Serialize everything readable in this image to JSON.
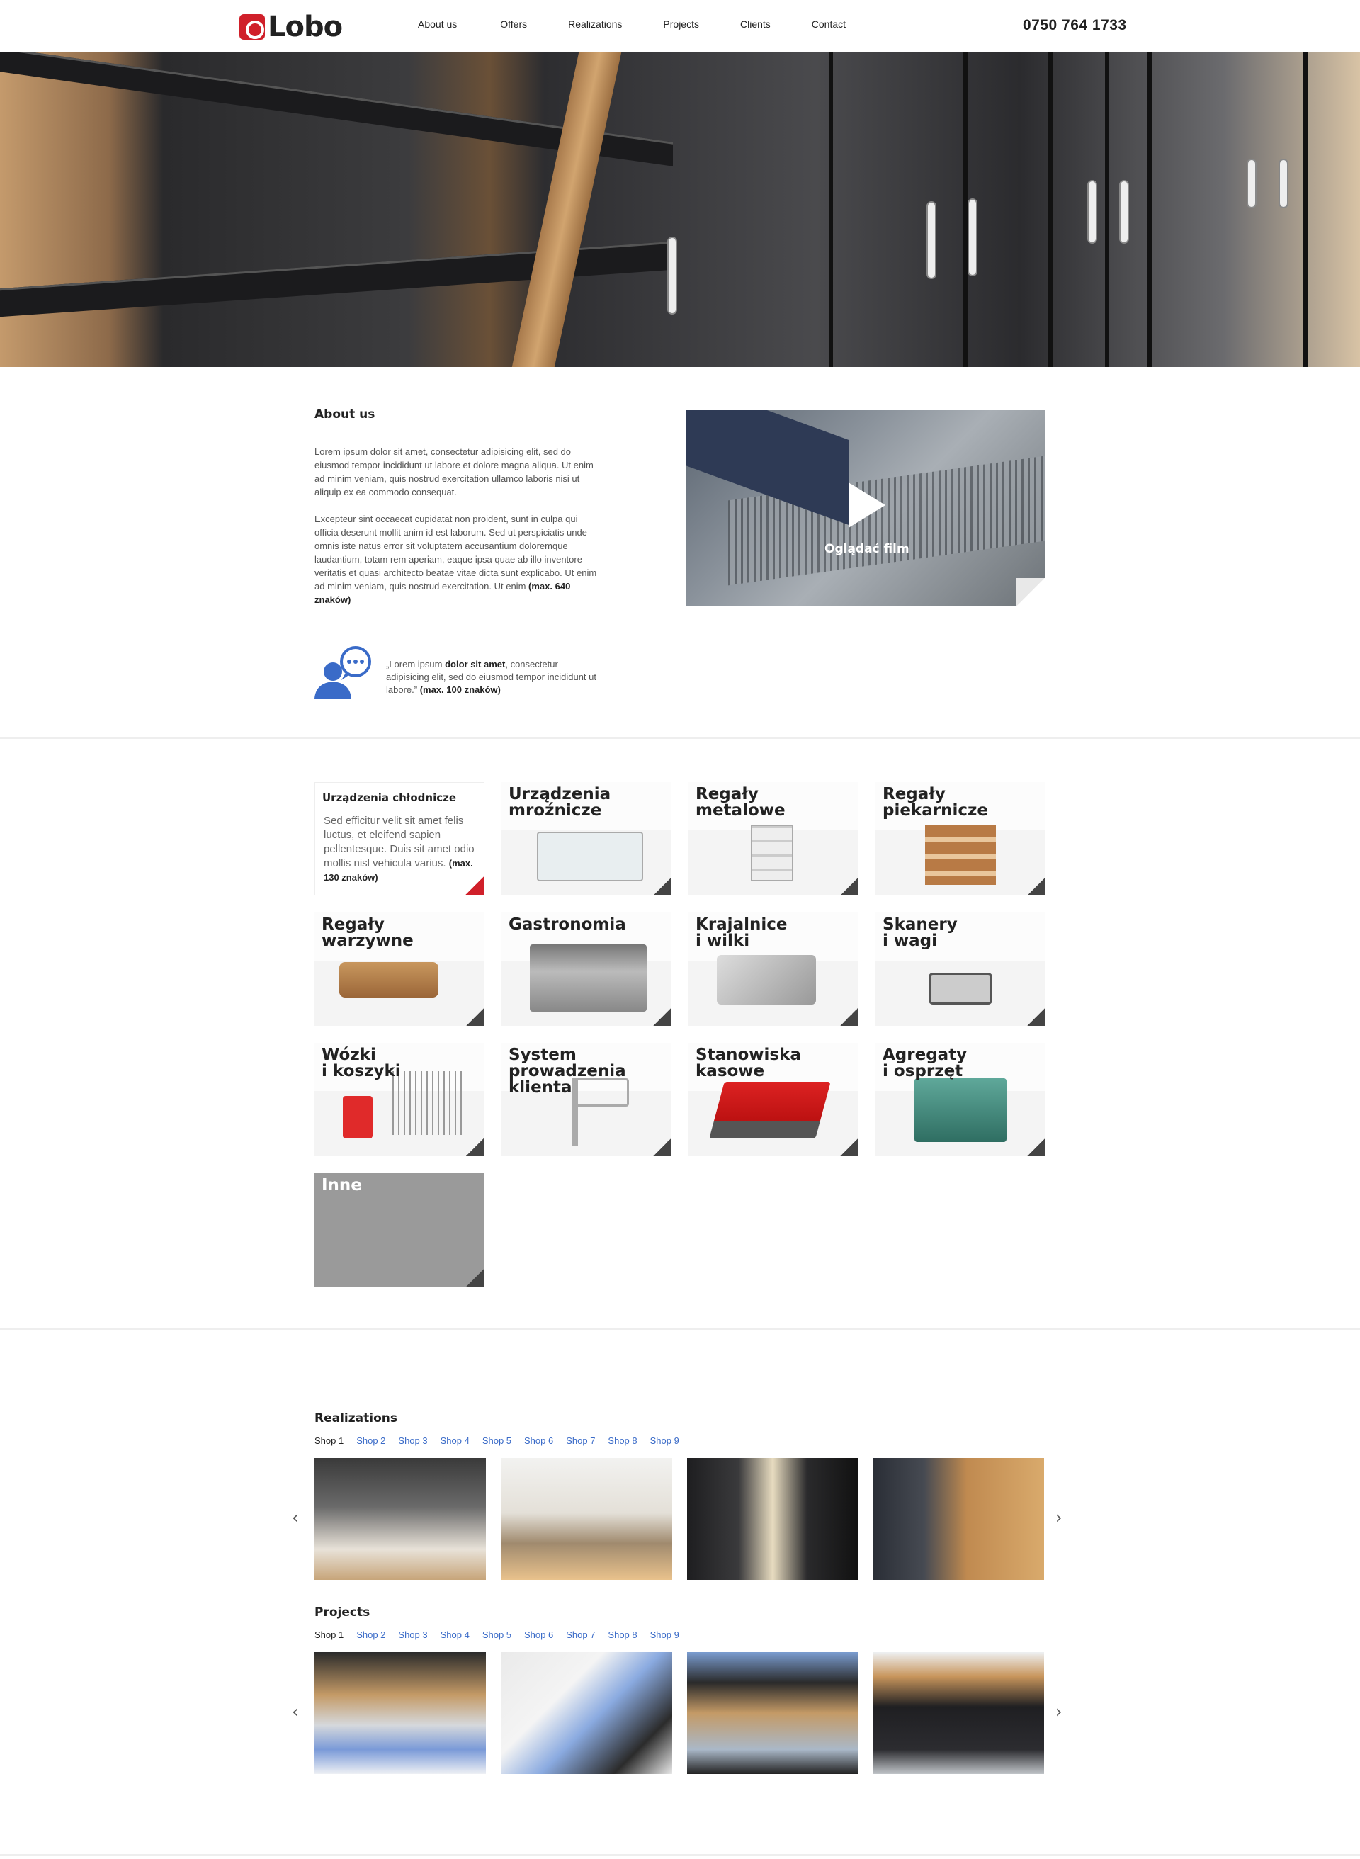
{
  "header": {
    "logo_text": "Lobo",
    "nav": [
      "About us",
      "Offers",
      "Realizations",
      "Projects",
      "Clients",
      "Contact"
    ],
    "phone": "0750 764 1733"
  },
  "about": {
    "title": "About us",
    "paragraph1": "Lorem ipsum dolor sit amet, consectetur adipisicing elit, sed do eiusmod tempor incididunt ut labore et dolore magna aliqua. Ut enim ad minim veniam, quis nostrud exercitation ullamco laboris nisi ut aliquip ex ea commodo consequat.",
    "paragraph2": "Excepteur sint occaecat cupidatat non proident, sunt in culpa qui officia deserunt mollit anim id est laborum. Sed ut perspiciatis unde omnis iste natus error sit voluptatem accusantium doloremque laudantium, totam rem aperiam, eaque ipsa quae ab illo inventore veritatis et quasi architecto beatae vitae dicta sunt explicabo. Ut enim ad minim veniam, quis nostrud exercitation. Ut enim",
    "paragraph2_note": "(max. 640 znaków)",
    "video_label": "Oglądać film",
    "quote_prefix": "„Lorem ipsum",
    "quote_bold": "dolor sit amet",
    "quote_rest": ", consectetur adipisicing elit, sed do eiusmod tempor incididunt ut labore.”",
    "quote_note": "(max. 100 znaków)"
  },
  "categories": [
    {
      "label": "Urządzenia chłodnicze",
      "desc": "Sed efficitur velit sit amet felis luctus, et eleifend sapien pellentesque. Duis sit amet odio mollis nisl vehicula varius.",
      "note": "(max. 130 znaków)"
    },
    {
      "label": "Urządzenia\nmroźnicze"
    },
    {
      "label": "Regały\nmetalowe"
    },
    {
      "label": "Regały\npiekarnicze"
    },
    {
      "label": "Regały\nwarzywne"
    },
    {
      "label": "Gastronomia"
    },
    {
      "label": "Krajalnice\ni wilki"
    },
    {
      "label": "Skanery\ni wagi"
    },
    {
      "label": "Wózki\ni koszyki"
    },
    {
      "label": "System\nprowadzenia\nklienta"
    },
    {
      "label": "Stanowiska\nkasowe"
    },
    {
      "label": "Agregaty\ni osprzęt"
    },
    {
      "label": "Inne"
    }
  ],
  "realizations": {
    "title": "Realizations",
    "tabs": [
      "Shop 1",
      "Shop 2",
      "Shop 3",
      "Shop 4",
      "Shop 5",
      "Shop 6",
      "Shop 7",
      "Shop 8",
      "Shop 9"
    ],
    "active_tab": "Shop 1"
  },
  "projects": {
    "title": "Projects",
    "tabs": [
      "Shop 1",
      "Shop 2",
      "Shop 3",
      "Shop 4",
      "Shop 5",
      "Shop 6",
      "Shop 7",
      "Shop 8",
      "Shop 9"
    ],
    "active_tab": "Shop 1"
  },
  "icons": {
    "prev": "chevron-left-icon",
    "next": "chevron-right-icon",
    "play": "play-icon"
  },
  "colors": {
    "brand": "#d0202a",
    "link": "#3a6bc8"
  }
}
